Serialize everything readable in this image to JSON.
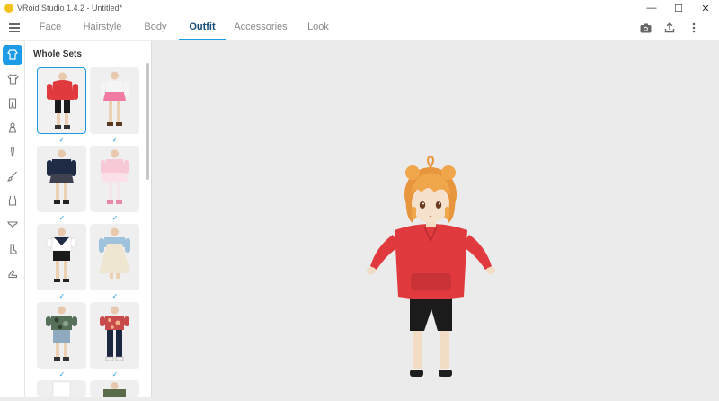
{
  "window": {
    "title": "VRoid Studio 1.4.2 - Untitled*",
    "minimize": "—",
    "maximize": "☐",
    "close": "✕"
  },
  "tabs": [
    {
      "label": "Face"
    },
    {
      "label": "Hairstyle"
    },
    {
      "label": "Body"
    },
    {
      "label": "Outfit",
      "active": true
    },
    {
      "label": "Accessories"
    },
    {
      "label": "Look"
    }
  ],
  "toolbar": {
    "icons": [
      "camera-icon",
      "share-icon",
      "more-icon"
    ]
  },
  "rail": {
    "icons": [
      "whole-set-icon",
      "shirt-icon",
      "pants-icon",
      "onepiece-icon",
      "tie-icon",
      "brush-icon",
      "tank-icon",
      "underwear-icon",
      "sock-icon",
      "shoe-icon"
    ]
  },
  "panel": {
    "title": "Whole Sets",
    "items": [
      {
        "name": "red-hoodie-set",
        "selected": true
      },
      {
        "name": "pink-school-set"
      },
      {
        "name": "navy-school-set"
      },
      {
        "name": "pink-maid-set"
      },
      {
        "name": "sailor-set"
      },
      {
        "name": "dress-jacket-set"
      },
      {
        "name": "camo-shirt-set"
      },
      {
        "name": "floral-shirt-set"
      },
      {
        "name": "white-set"
      },
      {
        "name": "green-coat-set"
      }
    ]
  },
  "colors": {
    "accent": "#1d9be6",
    "hoodie": "#e03a3f",
    "hair": "#f0a64a"
  }
}
